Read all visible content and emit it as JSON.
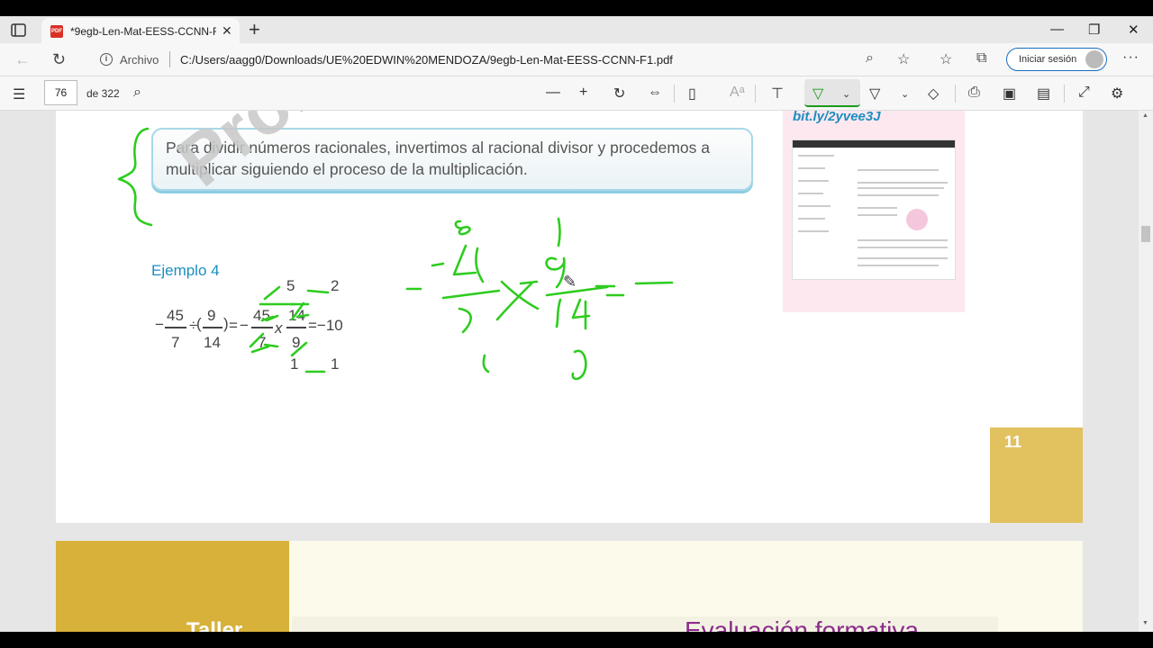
{
  "browser": {
    "tab_title": "*9egb-Len-Mat-EESS-CCNN-F1.pdf",
    "tab_icon_label": "PDF",
    "new_tab": "+",
    "address_prefix": "Archivo",
    "url": "C:/Users/aagg0/Downloads/UE%20EDWIN%20MENDOZA/9egb-Len-Mat-EESS-CCNN-F1.pdf",
    "signin_label": "Iniciar sesión"
  },
  "pdf_toolbar": {
    "current_page": "76",
    "page_count": "de 322"
  },
  "page": {
    "watermark": "Proh",
    "rule_text": "Para dividir números racionales, invertimos al racional divisor y procedemos a multiplicar siguiendo el proceso de la multiplicación.",
    "example_title": "Ejemplo 4",
    "side_link": "bit.ly/2yvee3J",
    "page_number": "11",
    "math": {
      "top_5": "5",
      "top_2": "2",
      "n45a": "45",
      "d7a": "7",
      "n9": "9",
      "d14": "14",
      "n45b": "45",
      "d7b": "7",
      "n14": "14",
      "d9": "9",
      "x": "x",
      "result": "=−10",
      "bot_1a": "1",
      "bot_1b": "1",
      "minus1": "−",
      "div": "÷",
      "eq1": "=",
      "minus2": "−",
      "paren_l": "(",
      "paren_r": ")"
    }
  },
  "next_page": {
    "left_title": "Taller",
    "right_title": "Evaluación formativa"
  },
  "colors": {
    "ink": "#2ecc1f",
    "link": "#1b8fc0",
    "accent": "#d8b13a"
  }
}
